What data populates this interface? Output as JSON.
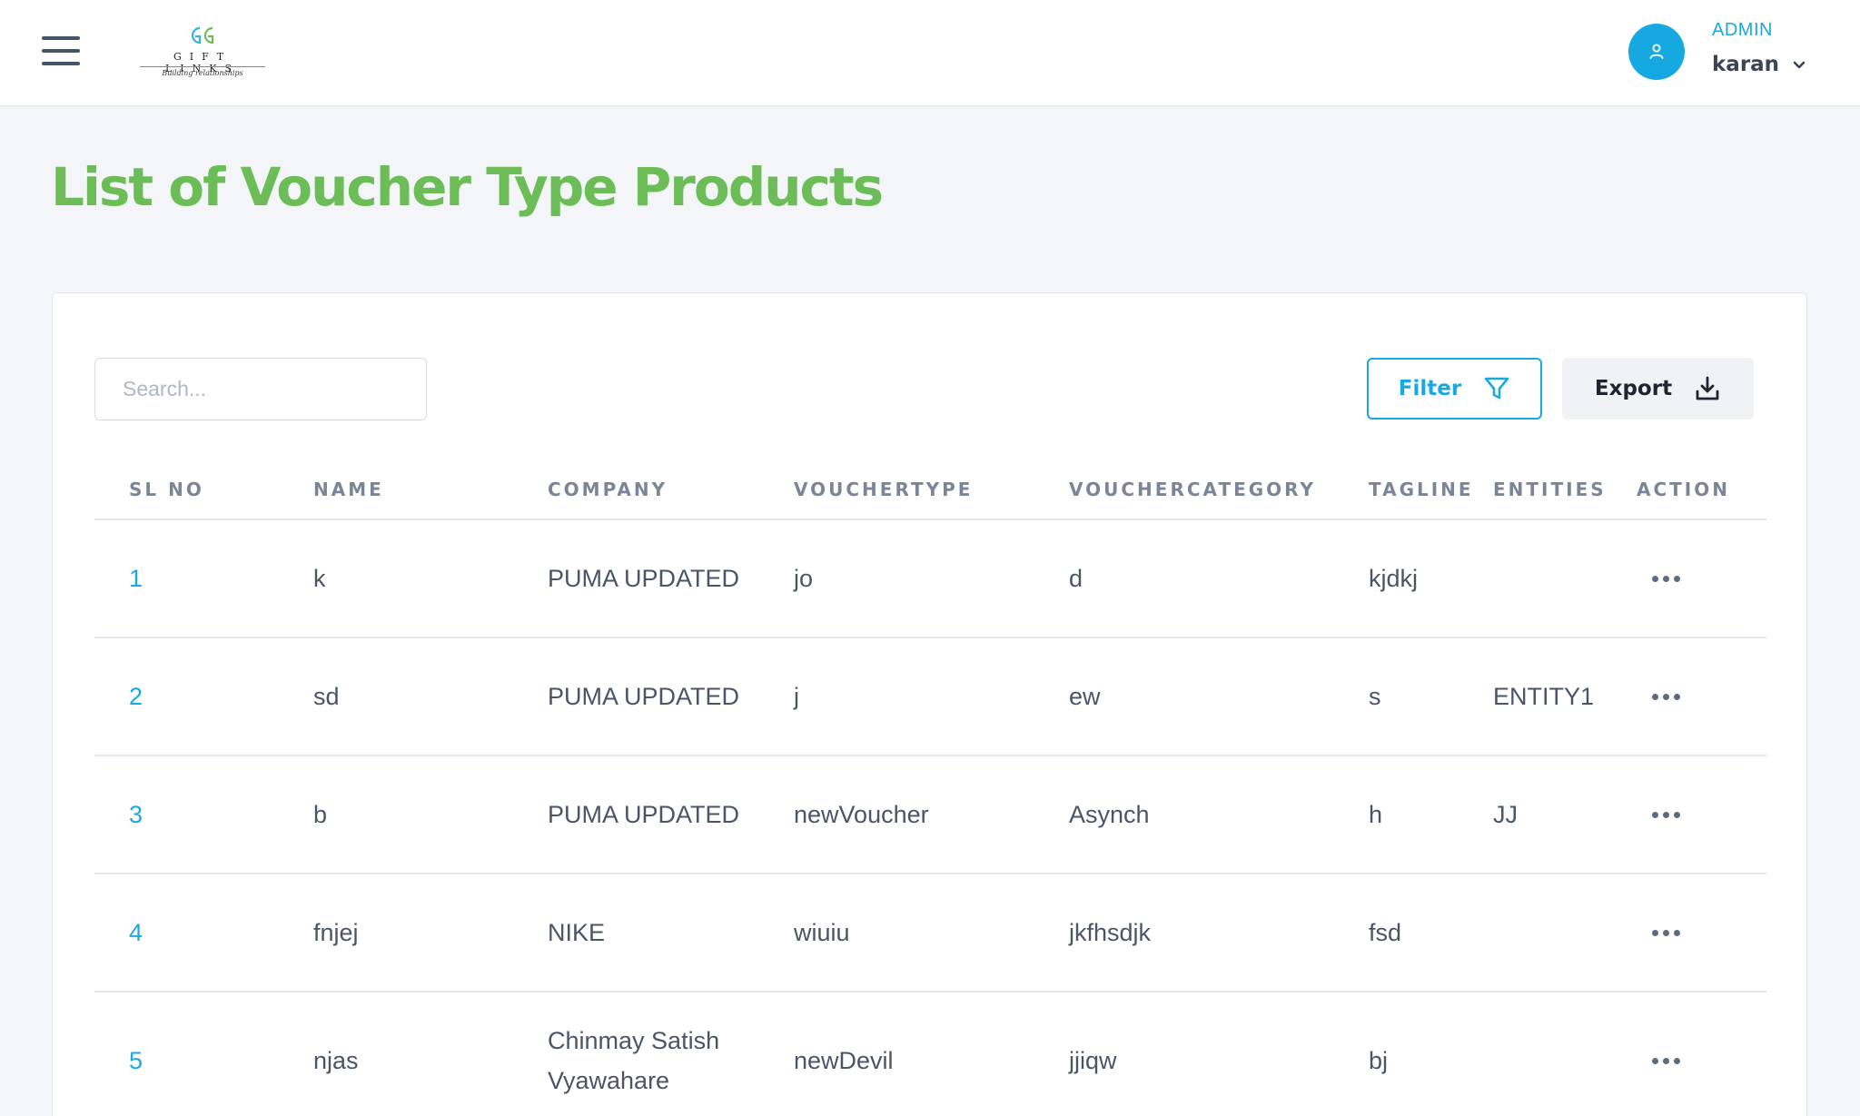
{
  "header": {
    "logo": {
      "text": "GIFT LINKS",
      "tagline": "Building relationships",
      "colors": [
        "#2fb3e0",
        "#6cbd57"
      ]
    },
    "user": {
      "role": "ADMIN",
      "name": "karan"
    }
  },
  "page": {
    "title": "List of Voucher Type Products"
  },
  "toolbar": {
    "search_placeholder": "Search...",
    "filter_label": "Filter",
    "export_label": "Export"
  },
  "table": {
    "columns": [
      "SL NO",
      "NAME",
      "COMPANY",
      "VOUCHERTYPE",
      "VOUCHERCATEGORY",
      "TAGLINE",
      "ENTITIES",
      "ACTION"
    ],
    "rows": [
      {
        "sl": "1",
        "name": "k",
        "company": "PUMA UPDATED",
        "vouchertype": "jo",
        "vouchercategory": "d",
        "tagline": "kjdkj",
        "entities": ""
      },
      {
        "sl": "2",
        "name": "sd",
        "company": "PUMA UPDATED",
        "vouchertype": "j",
        "vouchercategory": "ew",
        "tagline": "s",
        "entities": "ENTITY1"
      },
      {
        "sl": "3",
        "name": "b",
        "company": "PUMA UPDATED",
        "vouchertype": "newVoucher",
        "vouchercategory": "Asynch",
        "tagline": "h",
        "entities": "JJ"
      },
      {
        "sl": "4",
        "name": "fnjej",
        "company": "NIKE",
        "vouchertype": "wiuiu",
        "vouchercategory": "jkfhsdjk",
        "tagline": "fsd",
        "entities": ""
      },
      {
        "sl": "5",
        "name": "njas",
        "company": "Chinmay Satish Vyawahare",
        "vouchertype": "newDevil",
        "vouchercategory": "jjiqw",
        "tagline": "bj",
        "entities": ""
      }
    ]
  },
  "colors": {
    "title_green": "#6cbd57",
    "accent_blue": "#18a9e1",
    "page_bg": "#f4f5f8"
  },
  "icons": {
    "menu": "hamburger-icon",
    "avatar": "user-icon",
    "dropdown": "chevron-down-icon",
    "filter": "filter-icon",
    "export": "download-icon",
    "row_action": "more-horizontal-icon"
  }
}
